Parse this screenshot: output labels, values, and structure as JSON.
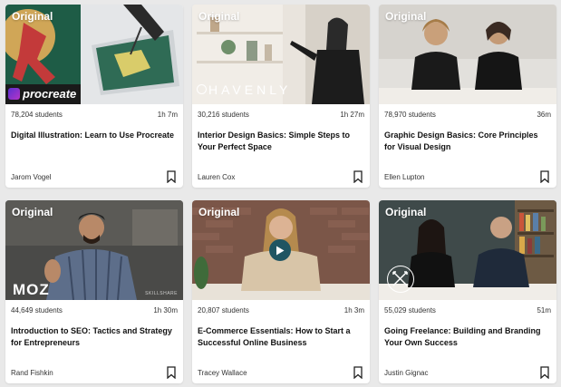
{
  "colors": {
    "background": "#e9e9e9",
    "card": "#ffffff",
    "badge_text": "#ffffff",
    "play_button": "#1f5562"
  },
  "courses": [
    {
      "badge": "Original",
      "students": "78,204 students",
      "duration": "1h 7m",
      "title": "Digital Illustration: Learn to Use Procreate",
      "author": "Jarom Vogel",
      "thumb_logo": "procreate",
      "bookmark_icon": "bookmark-icon"
    },
    {
      "badge": "Original",
      "students": "30,216 students",
      "duration": "1h 27m",
      "title": "Interior Design Basics: Simple Steps to Your Perfect Space",
      "author": "Lauren Cox",
      "thumb_logo": "HAVENLY",
      "bookmark_icon": "bookmark-icon"
    },
    {
      "badge": "Original",
      "students": "78,970 students",
      "duration": "36m",
      "title": "Graphic Design Basics: Core Principles for Visual Design",
      "author": "Ellen Lupton",
      "bookmark_icon": "bookmark-icon"
    },
    {
      "badge": "Original",
      "students": "44,649 students",
      "duration": "1h 30m",
      "title": "Introduction to SEO: Tactics and Strategy for Entrepreneurs",
      "author": "Rand Fishkin",
      "thumb_logo": "MOZ",
      "thumb_watermark": "SKILLSHARE",
      "bookmark_icon": "bookmark-icon"
    },
    {
      "badge": "Original",
      "students": "20,807 students",
      "duration": "1h 3m",
      "title": "E-Commerce Essentials: How to Start a Successful Online Business",
      "author": "Tracey Wallace",
      "play_icon": "play-icon",
      "bookmark_icon": "bookmark-icon"
    },
    {
      "badge": "Original",
      "students": "55,029 students",
      "duration": "51m",
      "title": "Going Freelance: Building and Branding Your Own Success",
      "author": "Justin Gignac",
      "thumb_logo_icon": "crossed-arrows-logo-icon",
      "bookmark_icon": "bookmark-icon"
    }
  ]
}
